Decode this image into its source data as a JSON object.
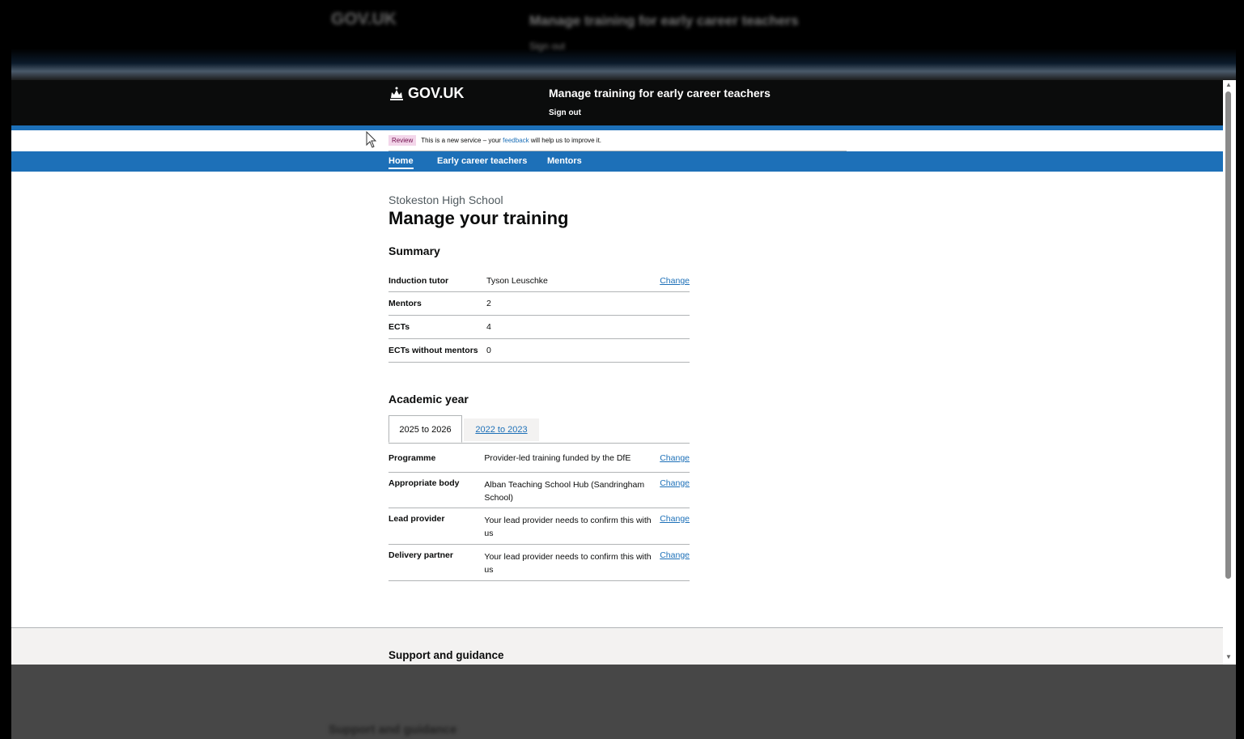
{
  "blurred_top": {
    "logo": "GOV.UK",
    "title": "Manage training for early career teachers",
    "signout": "Sign out"
  },
  "header": {
    "logo": "GOV.UK",
    "service_name": "Manage training for early career teachers",
    "signout": "Sign out"
  },
  "phase_banner": {
    "tag": "Review",
    "text_before": "This is a new service – your",
    "link": "feedback",
    "text_after": "will help us to improve it."
  },
  "nav": {
    "items": [
      "Home",
      "Early career teachers",
      "Mentors"
    ],
    "active": "Home"
  },
  "page": {
    "caption": "Stokeston High School",
    "title": "Manage your training"
  },
  "summary": {
    "heading": "Summary",
    "rows": [
      {
        "key": "Induction tutor",
        "value": "Tyson Leuschke",
        "action": "Change"
      },
      {
        "key": "Mentors",
        "value": "2",
        "action": ""
      },
      {
        "key": "ECTs",
        "value": "4",
        "action": ""
      },
      {
        "key": "ECTs without mentors",
        "value": "0",
        "action": ""
      }
    ]
  },
  "academic_year": {
    "heading": "Academic year",
    "tabs": [
      "2025 to 2026",
      "2022 to 2023"
    ],
    "selected_tab": "2025 to 2026",
    "rows": [
      {
        "key": "Programme",
        "value": "Provider-led training funded by the DfE",
        "action": "Change"
      },
      {
        "key": "Appropriate body",
        "value": "Alban Teaching School Hub (Sandringham School)",
        "action": "Change"
      },
      {
        "key": "Lead provider",
        "value": "Your lead provider needs to confirm this with us",
        "action": "Change"
      },
      {
        "key": "Delivery partner",
        "value": "Your lead provider needs to confirm this with us",
        "action": "Change"
      }
    ]
  },
  "footer": {
    "title": "Support and guidance"
  },
  "blurred_bottom": {
    "text": "Support and guidance"
  },
  "colors": {
    "header": "#0b0c0c",
    "brand_blue": "#1d70b8",
    "tag_bg": "#f3d6ea",
    "footer_bg": "#f3f2f1"
  }
}
